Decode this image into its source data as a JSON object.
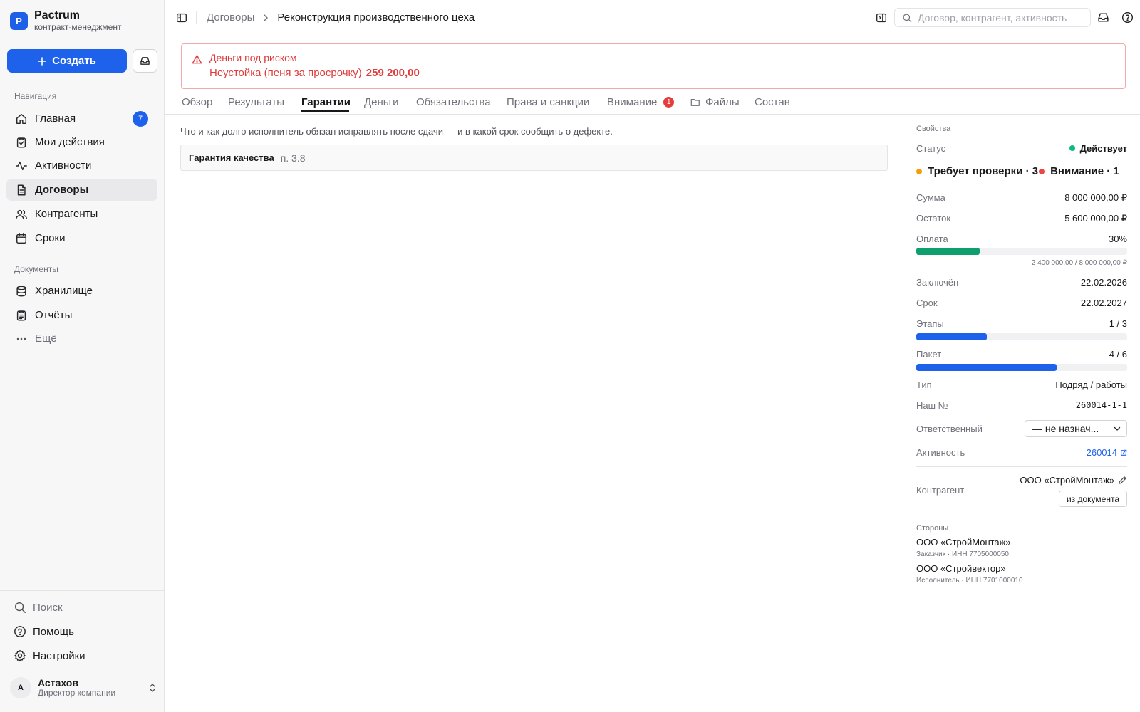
{
  "brand": {
    "logo_letter": "P",
    "name": "Pactrum",
    "subtitle": "контракт-менеджмент"
  },
  "sidebar": {
    "create_label": "Создать",
    "nav_section": "Навигация",
    "nav": [
      {
        "label": "Главная",
        "icon": "home-icon",
        "badge": "7"
      },
      {
        "label": "Мои действия",
        "icon": "clipboard-check-icon"
      },
      {
        "label": "Активности",
        "icon": "activity-icon"
      },
      {
        "label": "Договоры",
        "icon": "document-icon",
        "active": true
      },
      {
        "label": "Контрагенты",
        "icon": "users-icon"
      },
      {
        "label": "Сроки",
        "icon": "calendar-icon"
      }
    ],
    "docs_section": "Документы",
    "docs": [
      {
        "label": "Хранилище",
        "icon": "database-icon"
      },
      {
        "label": "Отчёты",
        "icon": "report-icon"
      },
      {
        "label": "Ещё",
        "icon": "more-icon"
      }
    ],
    "bottom": [
      {
        "label": "Поиск",
        "icon": "search-icon"
      },
      {
        "label": "Помощь",
        "icon": "help-icon"
      },
      {
        "label": "Настройки",
        "icon": "gear-icon"
      }
    ],
    "user": {
      "initial": "А",
      "name": "Астахов",
      "role": "Директор компании"
    }
  },
  "topbar": {
    "breadcrumb_parent": "Договоры",
    "breadcrumb_current": "Реконструкция производственного цеха",
    "search_placeholder": "Договор, контрагент, активность"
  },
  "alert": {
    "title": "Деньги под риском",
    "line": "Неустойка (пеня за просрочку)",
    "amount": "259 200,00"
  },
  "tabs": [
    {
      "label": "Обзор"
    },
    {
      "label": "Результаты"
    },
    {
      "label": "Гарантии",
      "active": true
    },
    {
      "label": "Деньги"
    },
    {
      "label": "Обязательства"
    },
    {
      "label": "Права и санкции"
    },
    {
      "label": "Внимание",
      "badge": "1"
    },
    {
      "label": "Файлы",
      "icon": "folder-icon"
    },
    {
      "label": "Состав"
    }
  ],
  "main": {
    "description": "Что и как долго исполнитель обязан исправлять после сдачи — и в какой срок сообщить о дефекте.",
    "guarantee": {
      "title": "Гарантия качества",
      "clause": "п. 3.8"
    }
  },
  "properties": {
    "section_label": "Свойства",
    "status_label": "Статус",
    "status_value": "Действует",
    "flag_review": "Требует проверки · 3",
    "flag_attention": "Внимание · 1",
    "sum_label": "Сумма",
    "sum_value": "8 000 000,00 ₽",
    "remain_label": "Остаток",
    "remain_value": "5 600 000,00 ₽",
    "pay_label": "Оплата",
    "pay_value": "30%",
    "pay_fraction": 0.3,
    "pay_detail": "2 400 000,00 / 8 000 000,00 ₽",
    "signed_label": "Заключён",
    "signed_value": "22.02.2026",
    "due_label": "Срок",
    "due_value": "22.02.2027",
    "stages_label": "Этапы",
    "stages_value": "1 / 3",
    "stages_fraction": 0.333,
    "package_label": "Пакет",
    "package_value": "4 / 6",
    "package_fraction": 0.667,
    "type_label": "Тип",
    "type_value": "Подряд / работы",
    "our_no_label": "Наш №",
    "our_no_value": "260014-1-1",
    "owner_label": "Ответственный",
    "owner_value": "— не назнач...",
    "activity_label": "Активность",
    "activity_value": "260014",
    "counterparty_label": "Контрагент",
    "counterparty_value": "ООО «СтройМонтаж»",
    "from_doc_button": "из документа",
    "parties_label": "Стороны",
    "parties": [
      {
        "name": "ООО «СтройМонтаж»",
        "role": "Заказчик · ИНН 7705000050"
      },
      {
        "name": "ООО «Стройвектор»",
        "role": "Исполнитель · ИНН 7701000010"
      }
    ]
  },
  "colors": {
    "accent": "#1e62ec",
    "danger": "#e03b3b",
    "status_active": "#10b981",
    "flag_review": "#f59e0b",
    "flag_attention": "#ef4444",
    "pay_bar": "#0e9f6e",
    "progress_bar": "#1e62ec"
  }
}
